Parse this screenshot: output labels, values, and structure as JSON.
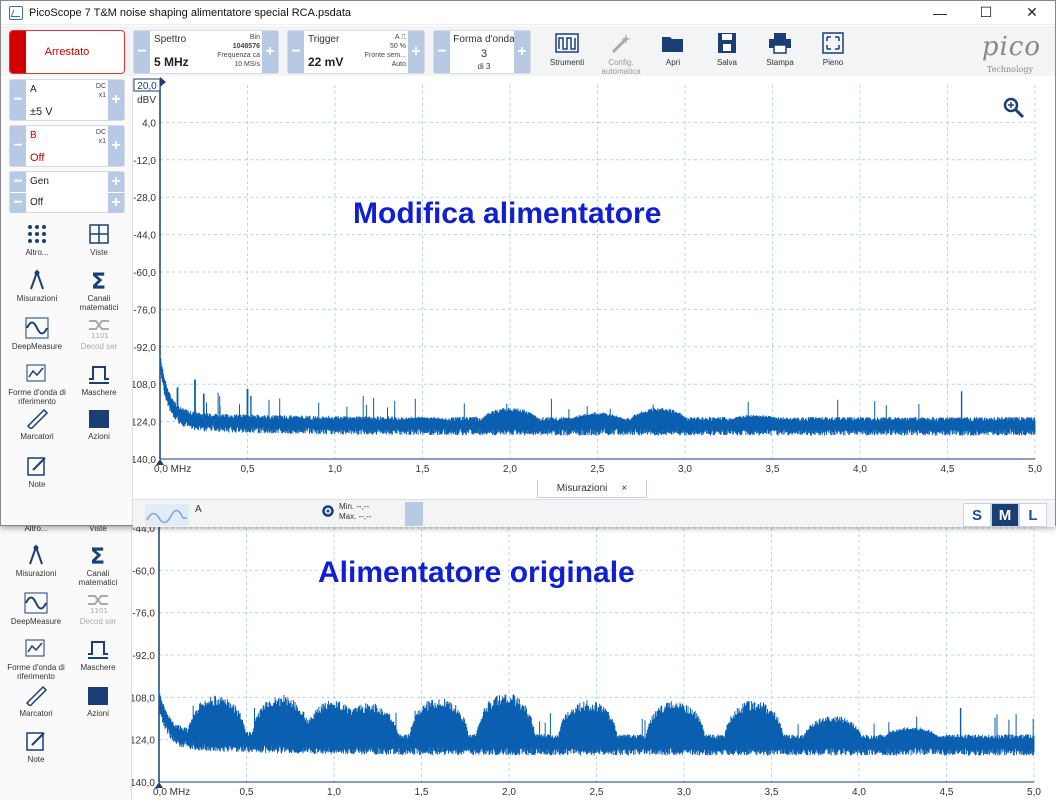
{
  "window": {
    "title": "PicoScope 7 T&M noise shaping alimentatore special RCA.psdata",
    "minimize": "—",
    "maximize": "☐",
    "close": "✕"
  },
  "toolbar": {
    "stop_label": "Arrestato",
    "spectrum": {
      "label": "Spettro",
      "value": "5 MHz",
      "bins_label": "Bin",
      "bins_value": "1048576",
      "freq_label": "Frequenza ca",
      "freq_value": "10 MS/s"
    },
    "trigger": {
      "label": "Trigger",
      "value": "22 mV",
      "channel": "A",
      "edge_icon": "rising-edge-icon",
      "percent": "50 %",
      "edge": "Fronte sem...",
      "mode": "Auto"
    },
    "waveform": {
      "label": "Forma d'onda",
      "value": "3",
      "of": "di 3"
    },
    "tools": [
      {
        "name": "strumenti",
        "label": "Strumenti"
      },
      {
        "name": "config-automatica",
        "label": "Config. automatica"
      },
      {
        "name": "apri",
        "label": "Apri"
      },
      {
        "name": "salva",
        "label": "Salva"
      },
      {
        "name": "stampa",
        "label": "Stampa"
      },
      {
        "name": "pieno",
        "label": "Pieno"
      }
    ],
    "logo": "pico",
    "logo_sub": "Technology"
  },
  "channels": {
    "a": {
      "name": "A",
      "coupling": "DC",
      "probe": "x1",
      "range": "±5 V"
    },
    "b": {
      "name": "B",
      "coupling": "DC",
      "probe": "x1",
      "range": "Off"
    },
    "gen": {
      "name": "Gen",
      "state": "Off"
    }
  },
  "sidebar_tools": {
    "altro": "Altro...",
    "viste": "Viste",
    "misurazioni": "Misurazioni",
    "canali_matematici": "Canali matematici",
    "deepmeasure": "DeepMeasure",
    "decod_ser": "Decod ser",
    "forme_riferimento": "Forme d'onda di riferimento",
    "maschere": "Maschere",
    "marcatori": "Marcatori",
    "azioni": "Azioni",
    "note": "Note"
  },
  "plot_top": {
    "overlay_title": "Modifica alimentatore",
    "y_unit": "dBV",
    "y_top_box": "20,0",
    "y_ticks": [
      "4,0",
      "-12,0",
      "-28,0",
      "-44,0",
      "-60,0",
      "-76,0",
      "-92,0",
      "-108,0",
      "-124,0",
      "-140,0"
    ],
    "x_ticks": [
      "0,0 MHz",
      "0,5",
      "1,0",
      "1,5",
      "2,0",
      "2,5",
      "3,0",
      "3,5",
      "4,0",
      "4,5",
      "5,0"
    ]
  },
  "plot_bottom": {
    "overlay_title": "Alimentatore originale",
    "y_ticks": [
      "-44,0",
      "-60,0",
      "-76,0",
      "-92,0",
      "-108,0",
      "-124,0",
      "-140,0"
    ],
    "x_ticks": [
      "0,0 MHz",
      "0,5",
      "1,0",
      "1,5",
      "2,0",
      "2,5",
      "3,0",
      "3,5",
      "4,0",
      "4,5",
      "5,0"
    ]
  },
  "measurements": {
    "tab_label": "Misurazioni",
    "tab_close": "×",
    "channel": "A",
    "min_label": "Min.",
    "min_value": "--,--",
    "max_label": "Max.",
    "max_value": "--,--",
    "sizes": [
      "S",
      "M",
      "L"
    ],
    "active_size": "M"
  },
  "colors": {
    "trace": "#0b5fb0",
    "grid": "#b5d6ec",
    "overlay_text": "#1020d0",
    "stop": "#d40000"
  },
  "chart_data": [
    {
      "type": "line",
      "title": "Modifica alimentatore",
      "ylabel": "dBV",
      "xlim": [
        0,
        5
      ],
      "ylim": [
        -140,
        20
      ],
      "x_unit": "MHz",
      "series": [
        {
          "envelope_hump_centers_mhz": [
            1.5,
            2.0,
            2.5,
            2.85,
            3.4
          ],
          "envelope_hump_peak_dbv": [
            -122,
            -118,
            -120,
            -118,
            -121
          ],
          "noise_floor_dbv": -125,
          "low_freq_start_dbv": -100,
          "spur_mhz": [
            0.2,
            0.25,
            0.5,
            0.52,
            4.58
          ],
          "spur_peak_dbv": [
            -106,
            -112,
            -110,
            -113,
            -111
          ]
        }
      ]
    },
    {
      "type": "line",
      "title": "Alimentatore originale",
      "ylabel": "dBV",
      "xlim": [
        0,
        5
      ],
      "ylim": [
        -140,
        -40
      ],
      "x_unit": "MHz",
      "series": [
        {
          "envelope_hump_centers_mhz": [
            0.33,
            0.7,
            1.0,
            1.2,
            1.6,
            1.98,
            2.45,
            2.95,
            3.4,
            3.85,
            4.3
          ],
          "envelope_hump_peak_dbv": [
            -107,
            -107,
            -109,
            -110,
            -108,
            -106,
            -109,
            -109,
            -109,
            -115,
            -119
          ],
          "noise_floor_dbv": -125,
          "low_freq_start_dbv": -110,
          "spur_mhz": [
            4.58
          ],
          "spur_peak_dbv": [
            -112
          ]
        }
      ]
    }
  ]
}
